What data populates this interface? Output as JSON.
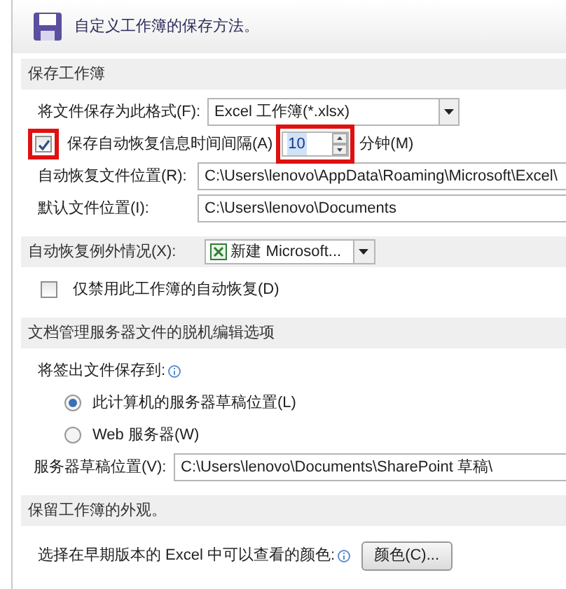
{
  "header": {
    "title": "自定义工作簿的保存方法。"
  },
  "sections": [
    {
      "title": "保存工作簿",
      "rows": [
        {
          "kind": "select",
          "label": "将文件保存为此格式(F):",
          "value": "Excel 工作簿(*.xlsx)"
        },
        {
          "kind": "spinner",
          "label": "保存自动恢复信息时间间隔(A)",
          "checked": true,
          "highlighted": true,
          "value": "10",
          "unit": "分钟(M)"
        },
        {
          "kind": "path",
          "label": "自动恢复文件位置(R):",
          "value": "C:\\Users\\lenovo\\AppData\\Roaming\\Microsoft\\Excel\\"
        },
        {
          "kind": "path",
          "label": "默认文件位置(I):",
          "value": "C:\\Users\\lenovo\\Documents"
        }
      ]
    },
    {
      "title": "自动恢复例外情况(X):",
      "workbook": "新建 Microsoft...",
      "rows": [
        {
          "kind": "check",
          "label": "仅禁用此工作簿的自动恢复(D)",
          "checked": false
        }
      ]
    },
    {
      "title": "文档管理服务器文件的脱机编辑选项",
      "rows": [
        {
          "kind": "caption",
          "label": "将签出文件保存到:"
        },
        {
          "kind": "radio",
          "label": "此计算机的服务器草稿位置(L)",
          "selected": true
        },
        {
          "kind": "radio",
          "label": "Web 服务器(W)",
          "selected": false
        },
        {
          "kind": "path",
          "label": "服务器草稿位置(V):",
          "value": "C:\\Users\\lenovo\\Documents\\SharePoint 草稿\\"
        }
      ]
    },
    {
      "title": "保留工作簿的外观。",
      "rows": [
        {
          "kind": "button",
          "label": "选择在早期版本的 Excel 中可以查看的颜色:",
          "button": "颜色(C)..."
        }
      ]
    }
  ]
}
